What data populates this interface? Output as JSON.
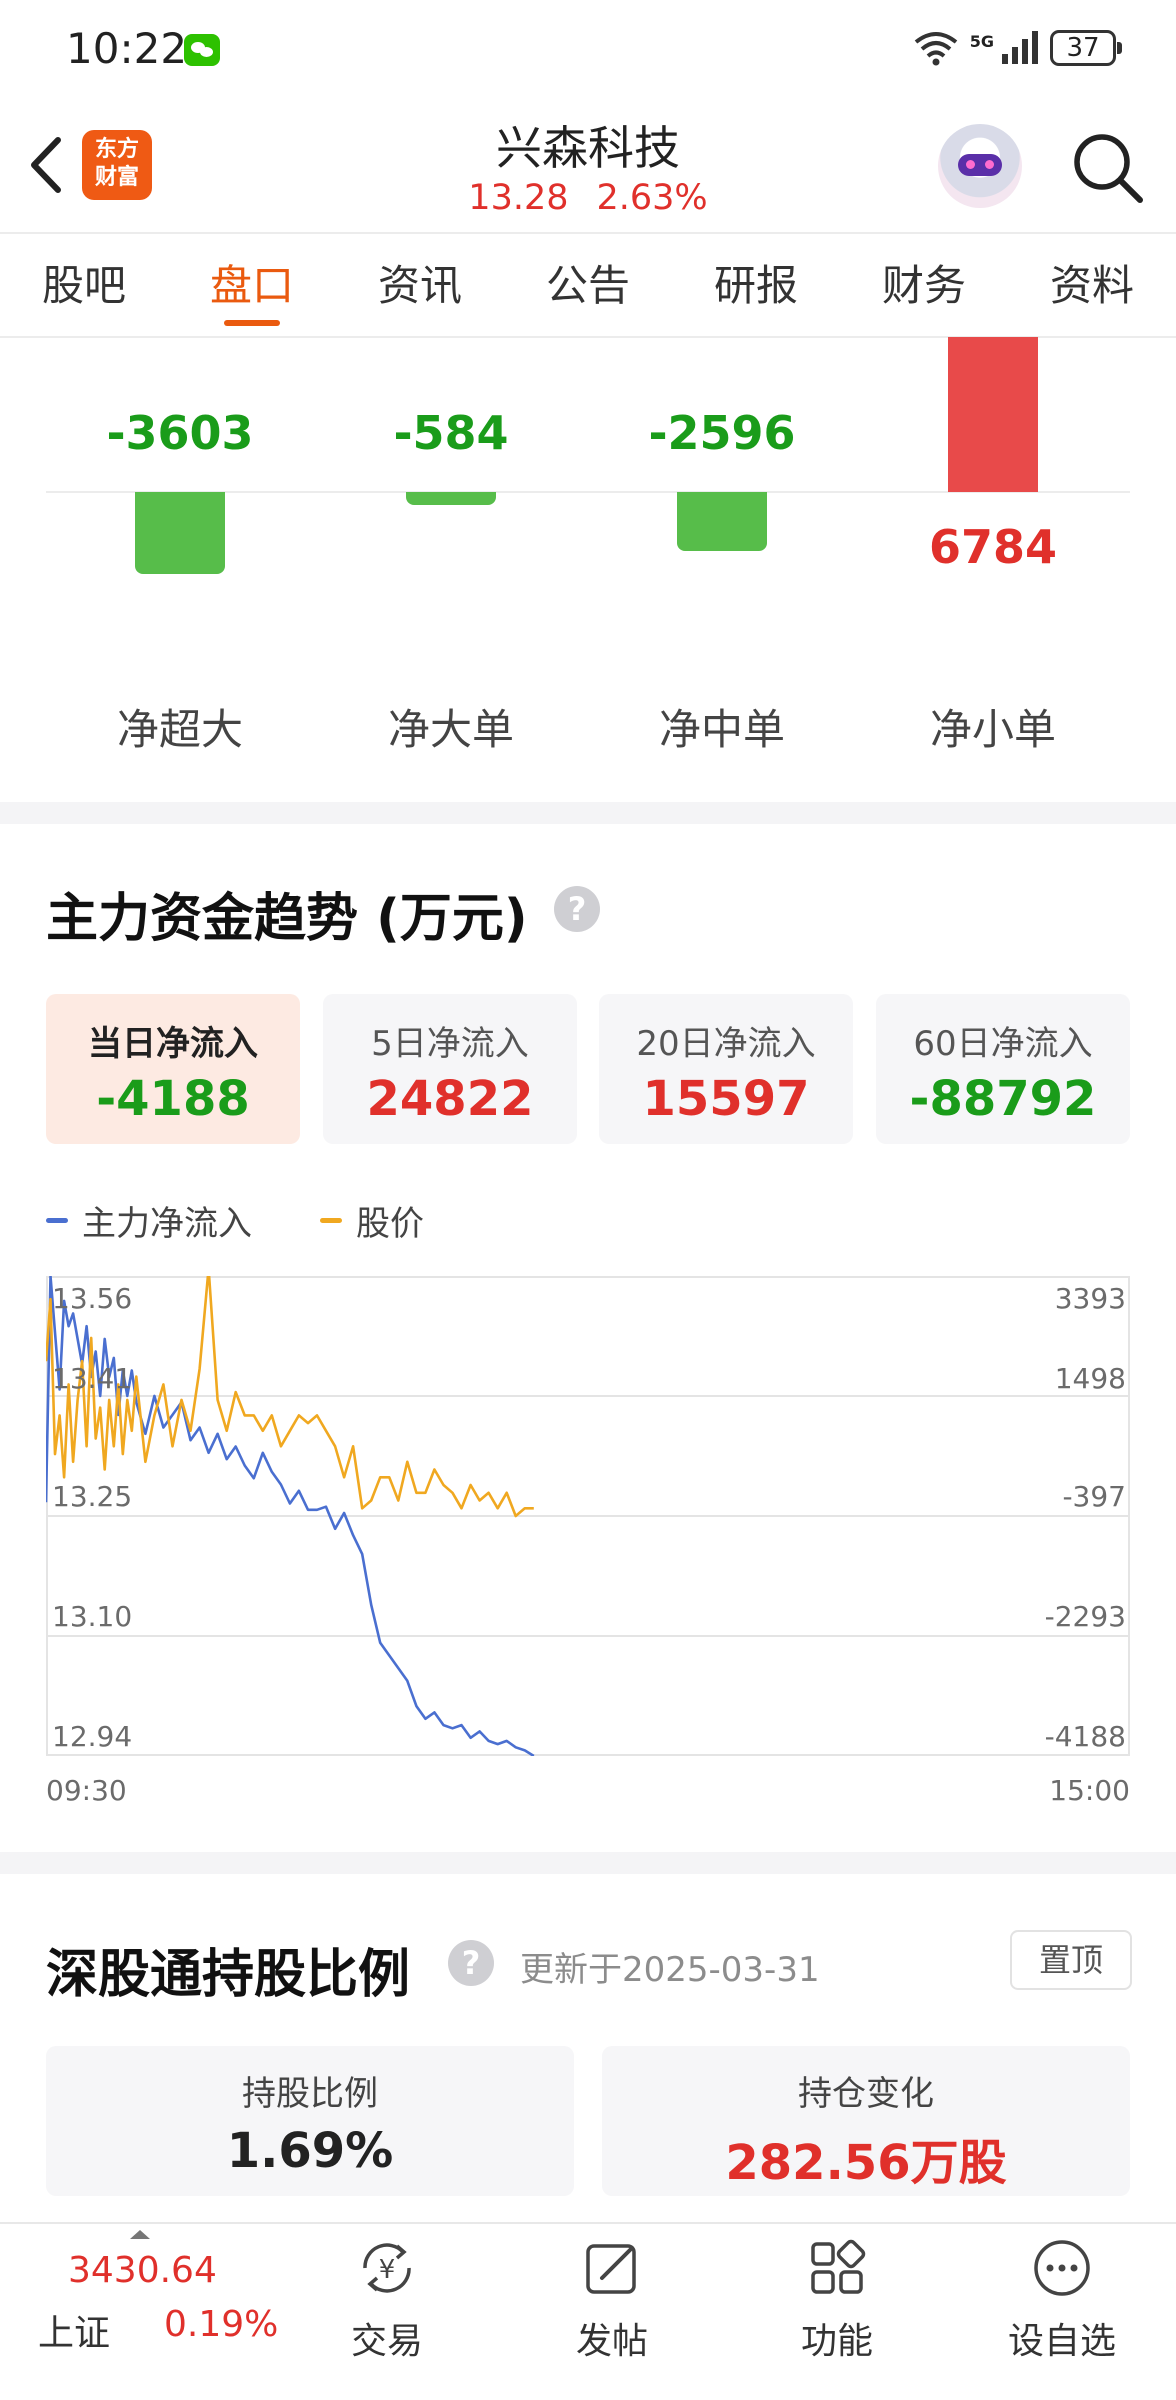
{
  "status_bar": {
    "time": "10:22",
    "battery": "37",
    "network": "5G",
    "icons": [
      "wechat-icon",
      "wifi-icon",
      "signal-icon",
      "battery-icon"
    ]
  },
  "header": {
    "stock_name": "兴森科技",
    "price": "13.28",
    "change_pct": "2.63%",
    "logo_text": [
      "东方",
      "财富"
    ],
    "icons": [
      "back-icon",
      "robot-avatar-icon",
      "search-icon"
    ]
  },
  "tabs": [
    {
      "label": "股吧",
      "active": false
    },
    {
      "label": "盘口",
      "active": true
    },
    {
      "label": "资讯",
      "active": false
    },
    {
      "label": "公告",
      "active": false
    },
    {
      "label": "研报",
      "active": false
    },
    {
      "label": "财务",
      "active": false
    },
    {
      "label": "资料",
      "active": false
    }
  ],
  "net_flow": {
    "items": [
      {
        "label": "净超大",
        "value": "-3603",
        "amount": -3603
      },
      {
        "label": "净大单",
        "value": "-584",
        "amount": -584
      },
      {
        "label": "净中单",
        "value": "-2596",
        "amount": -2596
      },
      {
        "label": "净小单",
        "value": "6784",
        "amount": 6784
      }
    ]
  },
  "trend": {
    "title": "主力资金趋势 (万元)",
    "help": "?",
    "cards": [
      {
        "label": "当日净流入",
        "value": "-4188",
        "active": true
      },
      {
        "label": "5日净流入",
        "value": "24822",
        "active": false
      },
      {
        "label": "20日净流入",
        "value": "15597",
        "active": false
      },
      {
        "label": "60日净流入",
        "value": "-88792",
        "active": false
      }
    ],
    "legend": [
      "主力净流入",
      "股价"
    ],
    "left_ticks": [
      "13.56",
      "13.41",
      "13.25",
      "13.10",
      "12.94"
    ],
    "right_ticks": [
      "3393",
      "1498",
      "-397",
      "-2293",
      "-4188"
    ],
    "x_ticks": [
      "09:30",
      "15:00"
    ]
  },
  "chart_data": {
    "type": "line",
    "title": "",
    "xlabel": "",
    "ylabel": "",
    "x_range": [
      "09:30",
      "15:00"
    ],
    "y_left_range": [
      12.94,
      13.56
    ],
    "y_right_range": [
      -4188,
      3393
    ],
    "grid": true,
    "legend_position": "top-left",
    "series": [
      {
        "name": "主力净流入",
        "color": "#4a6fd0",
        "axis": "right",
        "x_minutes": [
          0,
          1,
          2,
          3,
          4,
          5,
          6,
          8,
          9,
          10,
          11,
          12,
          13,
          14,
          15,
          16,
          17,
          18,
          19,
          20,
          22,
          24,
          26,
          28,
          30,
          32,
          34,
          36,
          38,
          40,
          42,
          44,
          46,
          48,
          50,
          52,
          54,
          56,
          58,
          60,
          62,
          64,
          66,
          68,
          70,
          72,
          74,
          76,
          78,
          80,
          82,
          84,
          86,
          88,
          90,
          92,
          94,
          96,
          98,
          100,
          102,
          104,
          106,
          108
        ],
        "values": [
          -180,
          3393,
          2500,
          1600,
          3000,
          2600,
          2800,
          2000,
          2600,
          1800,
          2200,
          1500,
          2400,
          1800,
          2100,
          1200,
          1900,
          1500,
          1900,
          1400,
          900,
          1500,
          1000,
          1200,
          1400,
          800,
          1000,
          600,
          900,
          500,
          700,
          400,
          200,
          600,
          300,
          100,
          -200,
          0,
          -300,
          -300,
          -250,
          -600,
          -350,
          -700,
          -1000,
          -1800,
          -2400,
          -2600,
          -2800,
          -3000,
          -3400,
          -3600,
          -3500,
          -3700,
          -3750,
          -3700,
          -3900,
          -3800,
          -3950,
          -4000,
          -3950,
          -4050,
          -4100,
          -4188
        ]
      },
      {
        "name": "股价",
        "color": "#f0a820",
        "axis": "left",
        "x_minutes": [
          0,
          1,
          2,
          3,
          4,
          5,
          6,
          7,
          8,
          9,
          10,
          11,
          12,
          13,
          14,
          15,
          16,
          17,
          18,
          19,
          20,
          22,
          24,
          26,
          28,
          30,
          32,
          34,
          36,
          38,
          40,
          42,
          44,
          46,
          48,
          50,
          52,
          54,
          56,
          58,
          60,
          62,
          64,
          66,
          68,
          70,
          72,
          74,
          76,
          78,
          80,
          82,
          84,
          86,
          88,
          90,
          92,
          94,
          96,
          98,
          100,
          102,
          104,
          106,
          108
        ],
        "values": [
          13.45,
          13.53,
          13.33,
          13.38,
          13.3,
          13.42,
          13.32,
          13.4,
          13.45,
          13.34,
          13.48,
          13.35,
          13.39,
          13.31,
          13.4,
          13.34,
          13.42,
          13.33,
          13.4,
          13.36,
          13.43,
          13.32,
          13.38,
          13.42,
          13.34,
          13.4,
          13.36,
          13.44,
          13.57,
          13.4,
          13.36,
          13.41,
          13.38,
          13.38,
          13.36,
          13.38,
          13.34,
          13.36,
          13.38,
          13.37,
          13.38,
          13.36,
          13.34,
          13.3,
          13.34,
          13.26,
          13.27,
          13.3,
          13.3,
          13.27,
          13.32,
          13.28,
          13.28,
          13.31,
          13.29,
          13.28,
          13.26,
          13.29,
          13.27,
          13.28,
          13.26,
          13.28,
          13.25,
          13.26,
          13.26
        ]
      }
    ]
  },
  "holding": {
    "title": "深股通持股比例",
    "help": "?",
    "update_text": "更新于2025-03-31",
    "pin_label": "置顶",
    "cards": [
      {
        "label": "持股比例",
        "value": "1.69%"
      },
      {
        "label": "持仓变化",
        "value": "282.56万股"
      }
    ]
  },
  "bottom_bar": {
    "index_value": "3430.64",
    "index_name": "上证",
    "index_change": "0.19%",
    "items": [
      {
        "label": "交易",
        "icon": "yuan-cycle-icon"
      },
      {
        "label": "发帖",
        "icon": "edit-icon"
      },
      {
        "label": "功能",
        "icon": "grid-icon"
      },
      {
        "label": "设自选",
        "icon": "more-icon"
      }
    ]
  },
  "colors": {
    "accent": "#ea5a0f",
    "up": "#e0302b",
    "down": "#1a9c1a",
    "bar_green": "#57bd4a",
    "bar_red": "#e84a4a",
    "line_blue": "#4a6fd0",
    "line_orange": "#f0a820"
  }
}
